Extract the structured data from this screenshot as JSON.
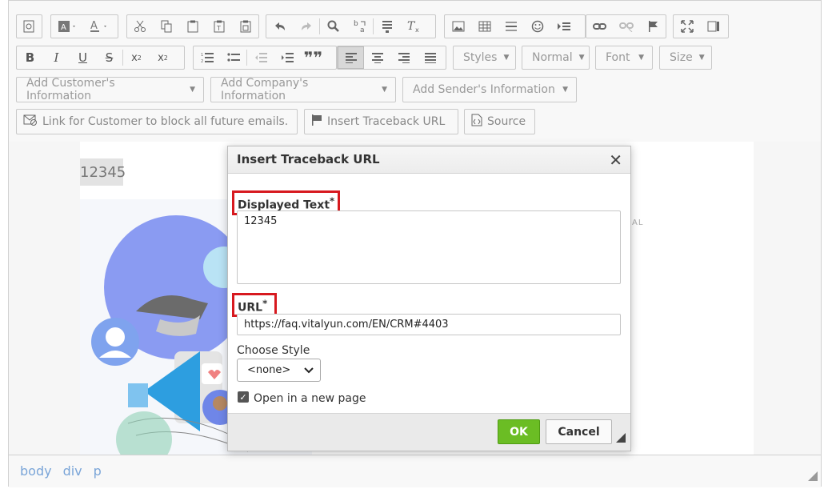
{
  "toolbar": {
    "format_combos": {
      "styles": "Styles",
      "format": "Normal",
      "font": "Font",
      "size": "Size"
    },
    "dropdowns": {
      "customer": "Add Customer's Information",
      "company": "Add Company's Information",
      "sender": "Add Sender's Information"
    },
    "buttons": {
      "block_link": "Link for Customer to block all future emails.",
      "traceback": "Insert Traceback URL",
      "source": "Source"
    }
  },
  "editor": {
    "sample_text": "12345",
    "partial_text": "AL",
    "path": [
      "body",
      "div",
      "p"
    ]
  },
  "dialog": {
    "title": "Insert Traceback URL",
    "displayed_text_label": "Displayed Text",
    "displayed_text_value": "12345",
    "url_label": "URL",
    "url_value": "https://faq.vitalyun.com/EN/CRM#4403",
    "required_mark": "*",
    "style_label": "Choose Style",
    "style_value": "<none>",
    "new_page_label": "Open in a new page",
    "new_page_checked": true,
    "ok_label": "OK",
    "cancel_label": "Cancel"
  },
  "colors": {
    "ok_green": "#6bbd24",
    "highlight_red": "#d7191f",
    "path_blue": "#7aa5d8"
  }
}
